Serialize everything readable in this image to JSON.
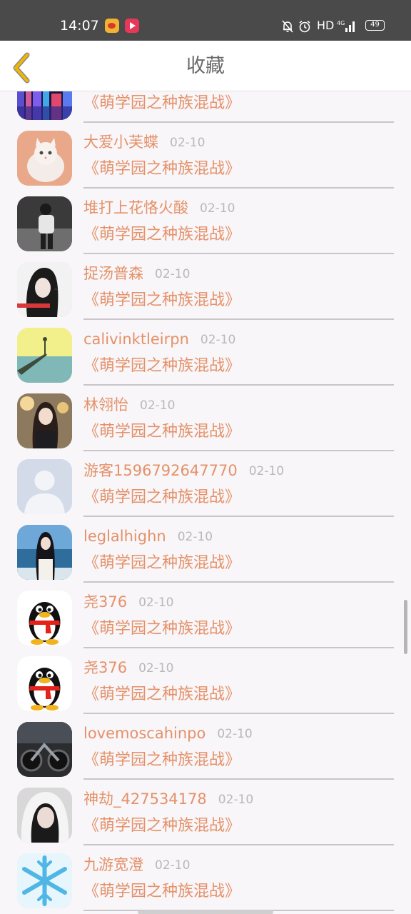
{
  "status_bar": {
    "time": "14:07",
    "hd_label": "HD",
    "battery": "49",
    "icons": [
      "weibo-app-icon",
      "video-app-icon",
      "bell-muted-icon",
      "alarm-icon",
      "signal-4g-icon",
      "battery-icon"
    ]
  },
  "header": {
    "title": "收藏",
    "back_icon": "chevron-left-icon",
    "accent_color": "#f2b600"
  },
  "theme": {
    "name_color": "#e5916a",
    "date_color": "#b9b9b9",
    "divider_color": "#c9c5c9"
  },
  "favorites": [
    {
      "name": "",
      "date": "",
      "title": "《萌学园之种族混战》",
      "avatar": "night-city-avatar"
    },
    {
      "name": "大爱小芙蝶",
      "date": "02-10",
      "title": "《萌学园之种族混战》",
      "avatar": "white-kitten-avatar"
    },
    {
      "name": "堆打上花恪火酸",
      "date": "02-10",
      "title": "《萌学园之种族混战》",
      "avatar": "grayscale-person-avatar"
    },
    {
      "name": "捉汤普森",
      "date": "02-10",
      "title": "《萌学园之种族混战》",
      "avatar": "girl-portrait-avatar"
    },
    {
      "name": "calivinktleirpn",
      "date": "02-10",
      "title": "《萌学园之种族混战》",
      "avatar": "pier-sunset-avatar"
    },
    {
      "name": "林翎怡",
      "date": "02-10",
      "title": "《萌学园之种族混战》",
      "avatar": "woman-photo-avatar"
    },
    {
      "name": "游客1596792647770",
      "date": "02-10",
      "title": "《萌学园之种族混战》",
      "avatar": "default-user-avatar"
    },
    {
      "name": "leglalhighn",
      "date": "02-10",
      "title": "《萌学园之种族混战》",
      "avatar": "girl-at-sea-avatar"
    },
    {
      "name": "尧376",
      "date": "02-10",
      "title": "《萌学园之种族混战》",
      "avatar": "qq-penguin-avatar"
    },
    {
      "name": "尧376",
      "date": "02-10",
      "title": "《萌学园之种族混战》",
      "avatar": "qq-penguin-avatar"
    },
    {
      "name": "lovemoscahinpo",
      "date": "02-10",
      "title": "《萌学园之种族混战》",
      "avatar": "dark-motorbike-avatar"
    },
    {
      "name": "神劫_427534178",
      "date": "02-10",
      "title": "《萌学园之种族混战》",
      "avatar": "hooded-girl-avatar"
    },
    {
      "name": "九游宽澄",
      "date": "02-10",
      "title": "《萌学园之种族混战》",
      "avatar": "snowflake-avatar"
    }
  ]
}
